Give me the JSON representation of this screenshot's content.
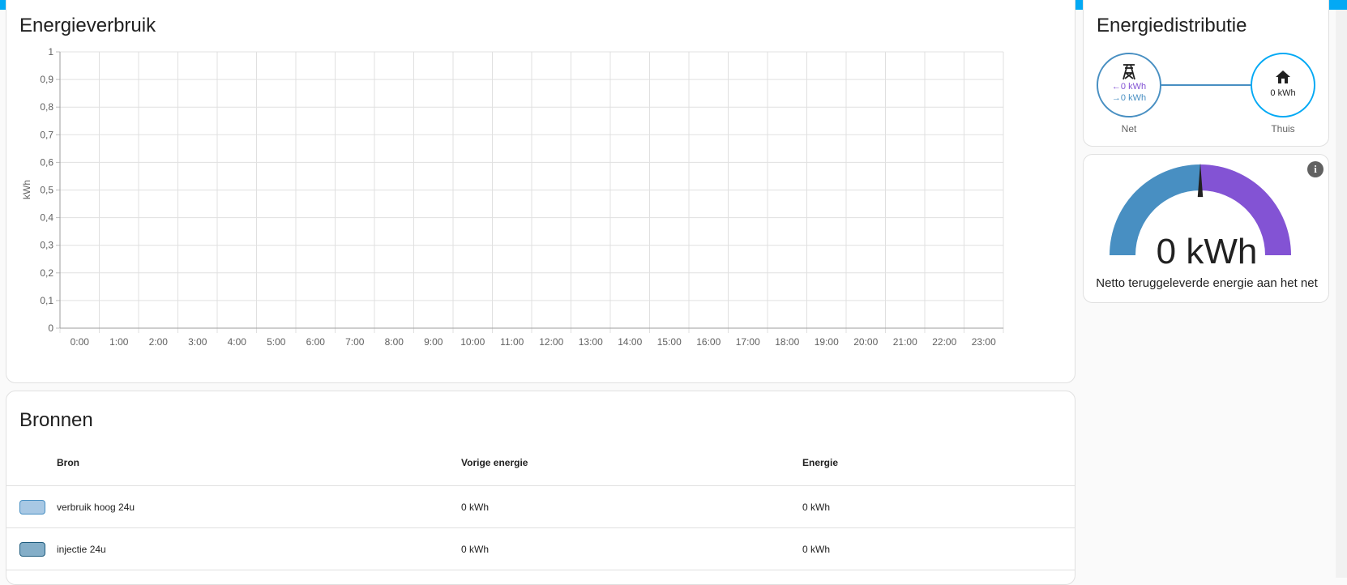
{
  "usage": {
    "title": "Energieverbruik",
    "chart_data": {
      "type": "bar",
      "title": "",
      "ylabel": "kWh",
      "xlabel": "",
      "ylim": [
        0,
        1
      ],
      "yticks": [
        "0",
        "0,1",
        "0,2",
        "0,3",
        "0,4",
        "0,5",
        "0,6",
        "0,7",
        "0,8",
        "0,9",
        "1"
      ],
      "categories": [
        "0:00",
        "1:00",
        "2:00",
        "3:00",
        "4:00",
        "5:00",
        "6:00",
        "7:00",
        "8:00",
        "9:00",
        "10:00",
        "11:00",
        "12:00",
        "13:00",
        "14:00",
        "15:00",
        "16:00",
        "17:00",
        "18:00",
        "19:00",
        "20:00",
        "21:00",
        "22:00",
        "23:00"
      ],
      "grid": true,
      "series": []
    }
  },
  "distribution": {
    "title": "Energiedistributie",
    "grid": {
      "label": "Net",
      "from_grid": "0 kWh",
      "to_grid": "0 kWh",
      "icon": "transmission-tower-icon",
      "color": "#488fc2"
    },
    "home": {
      "label": "Thuis",
      "value": "0 kWh",
      "icon": "home-icon",
      "color": "#03a9f4"
    },
    "arrow_in": "←",
    "arrow_out": "→"
  },
  "gauge": {
    "value": "0 kWh",
    "name": "Netto teruggeleverde energie aan het net",
    "needle_fraction": 0.5,
    "colors": {
      "left": "#488fc2",
      "right": "#8353d4"
    },
    "info_icon": "i"
  },
  "sources": {
    "title": "Bronnen",
    "columns": {
      "source": "Bron",
      "previous": "Vorige energie",
      "energy": "Energie"
    },
    "rows": [
      {
        "name": "verbruik hoog 24u",
        "previous": "0 kWh",
        "energy": "0 kWh",
        "fill": "#a8c8e4",
        "border": "#488fc2"
      },
      {
        "name": "injectie 24u",
        "previous": "0 kWh",
        "energy": "0 kWh",
        "fill": "#84aec8",
        "border": "#1f5c7e"
      }
    ]
  }
}
